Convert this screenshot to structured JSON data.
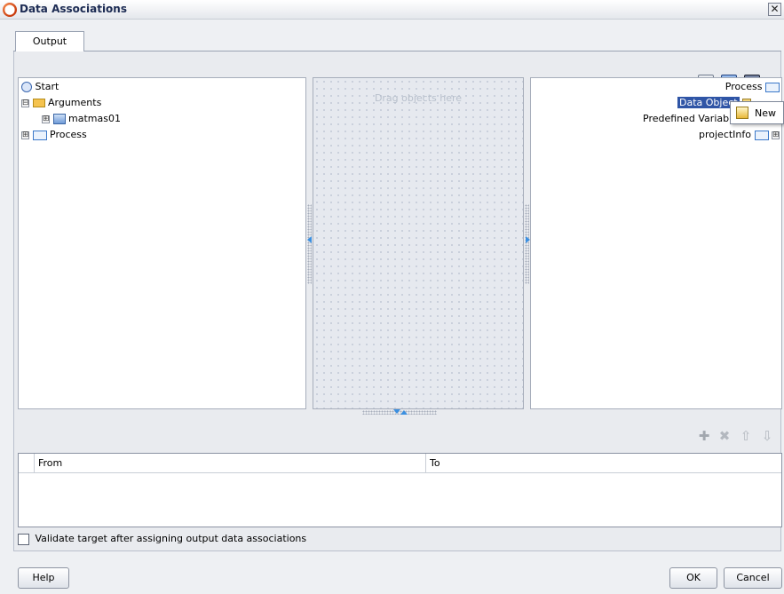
{
  "window": {
    "title": "Data Associations",
    "close_glyph": "✕"
  },
  "tabs": [
    {
      "label": "Output",
      "selected": true
    }
  ],
  "toolbar": {
    "icons": [
      "xpath-expression-icon",
      "save-mapping-icon",
      "binoculars-search-icon"
    ]
  },
  "source_tree": {
    "items": [
      {
        "label": "Start",
        "icon": "start-icon"
      },
      {
        "label": "Arguments",
        "icon": "folder-icon",
        "expander": "⊟"
      },
      {
        "label": "matmas01",
        "icon": "variable-icon",
        "expander": "⊞"
      },
      {
        "label": "Process",
        "icon": "process-icon",
        "expander": "⊞"
      }
    ]
  },
  "mapping_canvas": {
    "hint": "Drag objects here"
  },
  "target_tree": {
    "items": [
      {
        "label": "Process",
        "icon": "process-icon"
      },
      {
        "label": "Data Object",
        "icon": "folder-icon",
        "selected": true
      },
      {
        "label": "Predefined Variab",
        "icon": "folder-icon"
      },
      {
        "label": "projectInfo",
        "icon": "process-icon",
        "expander": "⊞"
      }
    ]
  },
  "context_menu": {
    "items": [
      {
        "label": "New",
        "icon": "new-icon"
      }
    ]
  },
  "table_toolbar": {
    "add": "✚",
    "delete": "✖",
    "up": "⇧",
    "down": "⇩"
  },
  "associations_table": {
    "columns": [
      "From",
      "To"
    ],
    "rows": []
  },
  "validate_option": {
    "label": "Validate target after assigning output data associations",
    "checked": false
  },
  "buttons": {
    "help": "Help",
    "ok": "OK",
    "cancel": "Cancel"
  },
  "colors": {
    "selection": "#2f55a6",
    "splitter_arrow": "#3b8fe0"
  }
}
